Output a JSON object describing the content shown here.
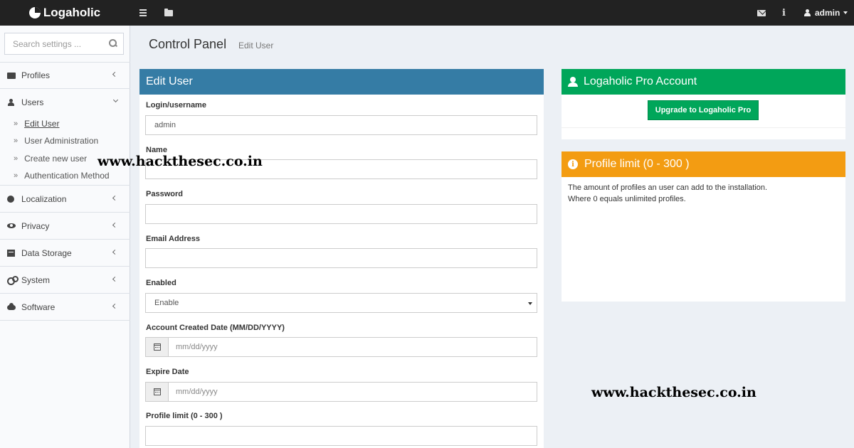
{
  "app": {
    "brand": "Logaholic",
    "user_label": "admin"
  },
  "topbar_icons": {
    "menu": "bars-icon",
    "folder": "folder-open-icon",
    "mail": "envelope-icon",
    "info": "info-icon",
    "user": "user-icon"
  },
  "sidebar": {
    "search_placeholder": "Search settings ...",
    "items": [
      {
        "label": "Profiles",
        "icon": "folder-open-icon"
      },
      {
        "label": "Users",
        "icon": "user-icon"
      },
      {
        "label": "Localization",
        "icon": "globe-icon"
      },
      {
        "label": "Privacy",
        "icon": "eye-icon"
      },
      {
        "label": "Data Storage",
        "icon": "hdd-icon"
      },
      {
        "label": "System",
        "icon": "gears-icon"
      },
      {
        "label": "Software",
        "icon": "cloud-icon"
      }
    ],
    "users_subitems": [
      {
        "label": "Edit User",
        "active": true
      },
      {
        "label": "User Administration",
        "active": false
      },
      {
        "label": "Create new user",
        "active": false
      },
      {
        "label": "Authentication Method",
        "active": false
      }
    ]
  },
  "header": {
    "title": "Control Panel",
    "subtitle": "Edit User"
  },
  "edit_user": {
    "title": "Edit User",
    "login_label": "Login/username",
    "login_value": "admin",
    "name_label": "Name",
    "name_value": "",
    "password_label": "Password",
    "password_value": "",
    "email_label": "Email Address",
    "email_value": "",
    "enabled_label": "Enabled",
    "enabled_value": "Enable",
    "created_label": "Account Created Date (MM/DD/YYYY)",
    "created_placeholder": "mm/dd/yyyy",
    "expire_label": "Expire Date",
    "expire_placeholder": "mm/dd/yyyy",
    "profile_limit_label": "Profile limit (0 - 300 )",
    "profile_limit_value": ""
  },
  "pro_account": {
    "title": "Logaholic Pro Account",
    "button": "Upgrade to Logaholic Pro"
  },
  "profile_limit_info": {
    "title": "Profile limit (0 - 300 )",
    "line1": "The amount of profiles an user can add to the installation.",
    "line2": "Where 0 equals unlimited profiles."
  },
  "watermark": "www.hackthesec.co.in",
  "colors": {
    "topbar": "#222222",
    "primary_header": "#357ca5",
    "success": "#00a65a",
    "warning": "#f39c12",
    "content_bg": "#ecf0f5"
  }
}
